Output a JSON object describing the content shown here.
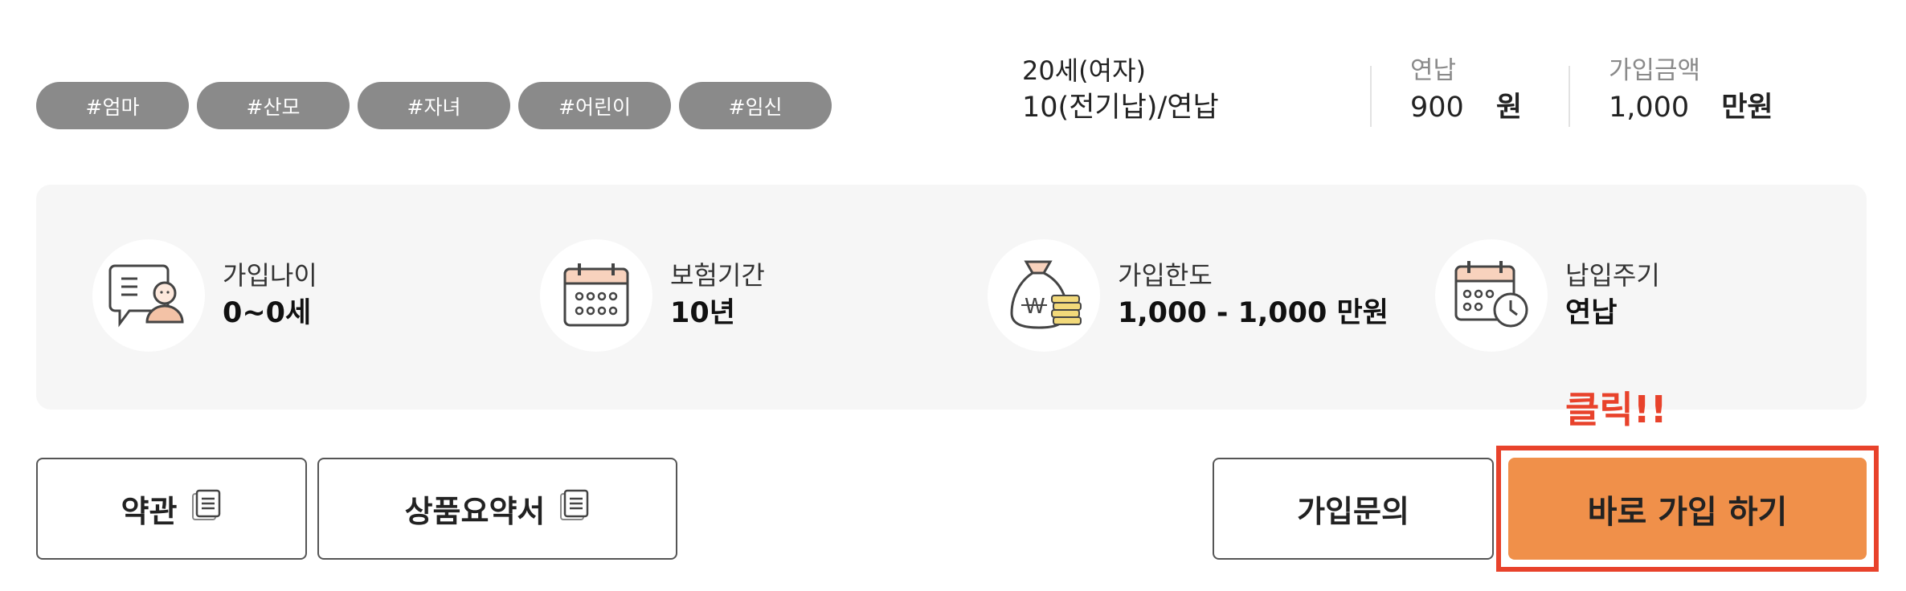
{
  "tags": [
    "#엄마",
    "#산모",
    "#자녀",
    "#어린이",
    "#임신"
  ],
  "summary": {
    "age_gender": "20세(여자)",
    "period": "10(전기납)/연납",
    "premium_label": "연납",
    "premium_value": "900",
    "premium_unit": "원",
    "amount_label": "가입금액",
    "amount_value": "1,000",
    "amount_unit": "만원"
  },
  "info": [
    {
      "icon": "age-consult-icon",
      "label": "가입나이",
      "value": "0~0세"
    },
    {
      "icon": "calendar-icon",
      "label": "보험기간",
      "value": "10년"
    },
    {
      "icon": "money-bag-icon",
      "label": "가입한도",
      "value": "1,000 - 1,000 만원"
    },
    {
      "icon": "calendar-clock-icon",
      "label": "납입주기",
      "value": "연납"
    }
  ],
  "click_note": "클릭!!",
  "buttons": {
    "terms": "약관",
    "summary_doc": "상품요약서",
    "inquiry": "가입문의",
    "join_now": "바로 가입 하기"
  },
  "colors": {
    "tag_bg": "#8a8a8a",
    "panel_bg": "#f6f6f6",
    "primary": "#f0904a",
    "highlight": "#e8422b"
  }
}
